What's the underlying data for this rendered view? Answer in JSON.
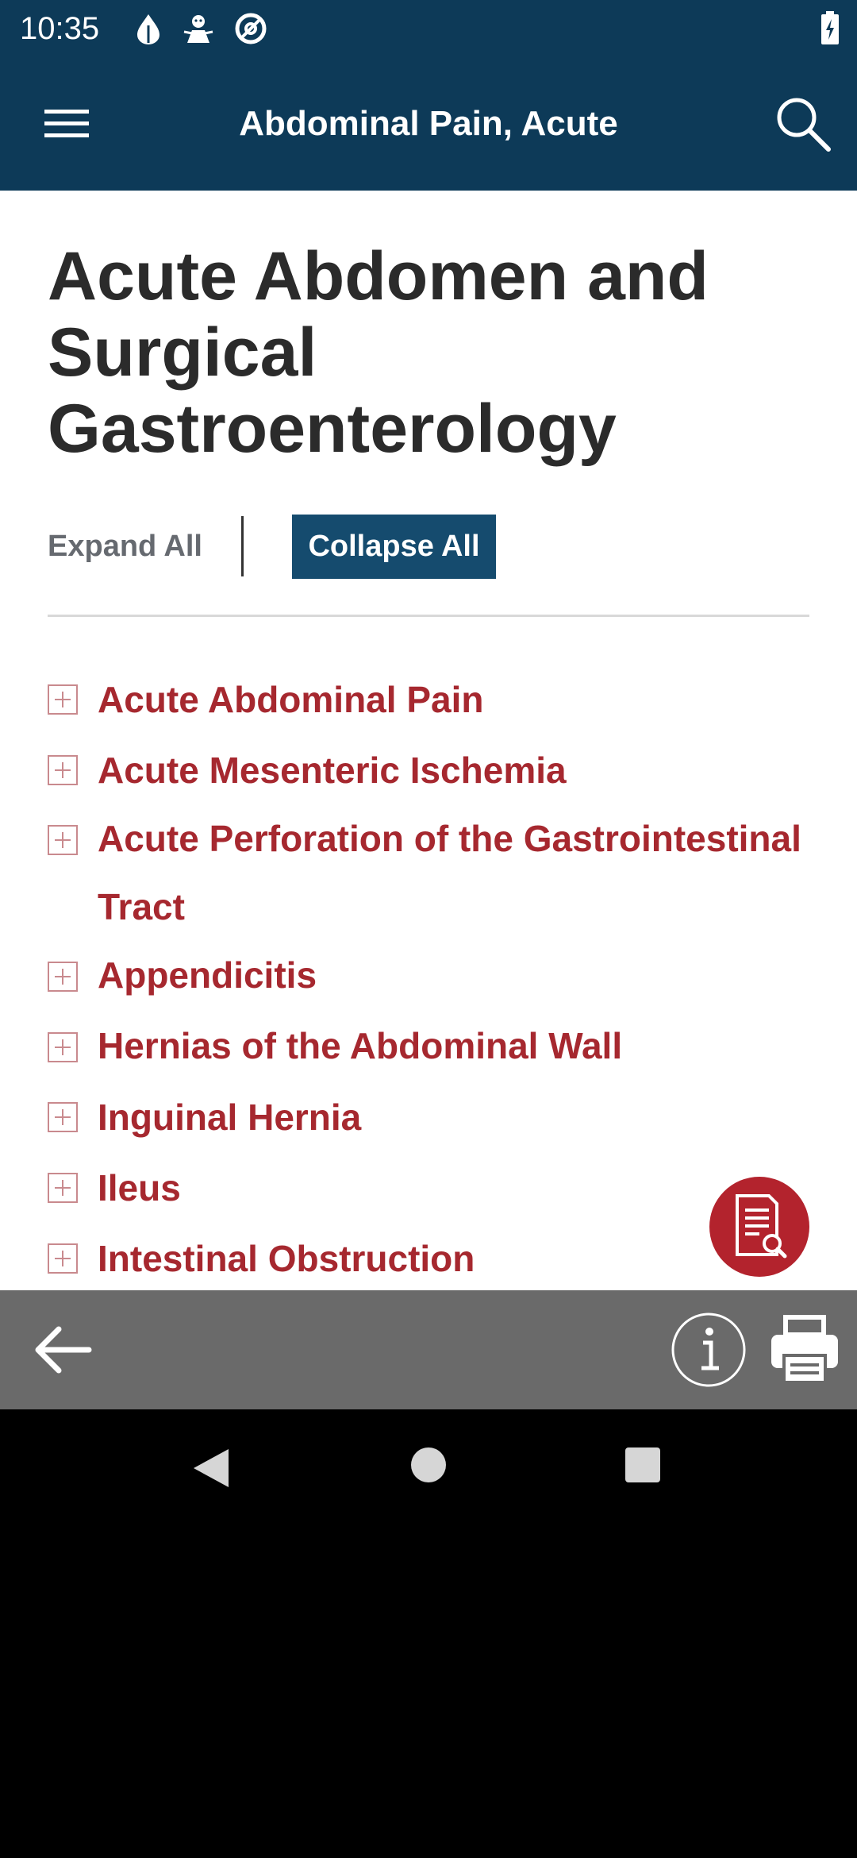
{
  "status_bar": {
    "time": "10:35",
    "icons": [
      "leaf-drop-icon",
      "android-debug-icon",
      "no-entry-at-icon"
    ],
    "battery": "battery-charging-icon"
  },
  "app_bar": {
    "title": "Abdominal Pain, Acute",
    "menu_icon": "hamburger-menu-icon",
    "search_icon": "search-icon"
  },
  "page": {
    "title": "Acute Abdomen and Surgical Gastroenterology",
    "expand_all_label": "Expand All",
    "collapse_all_label": "Collapse All"
  },
  "topics": [
    {
      "label": "Acute Abdominal Pain"
    },
    {
      "label": "Acute Mesenteric Ischemia"
    },
    {
      "label": "Acute Perforation of the Gastrointestinal",
      "label_cont": "Tract"
    },
    {
      "label": "Appendicitis"
    },
    {
      "label": "Hernias of the Abdominal Wall"
    },
    {
      "label": "Inguinal Hernia"
    },
    {
      "label": "Ileus"
    },
    {
      "label": "Intestinal Obstruction"
    }
  ],
  "fab": {
    "icon": "document-search-icon"
  },
  "toolbar": {
    "back_icon": "arrow-left-icon",
    "info_icon": "info-icon",
    "print_icon": "printer-icon"
  },
  "colors": {
    "header": "#0d3a58",
    "collapse_button": "#154b6e",
    "topic_text": "#a6282f",
    "fab": "#b3232d",
    "toolbar": "#6a6a6a"
  }
}
